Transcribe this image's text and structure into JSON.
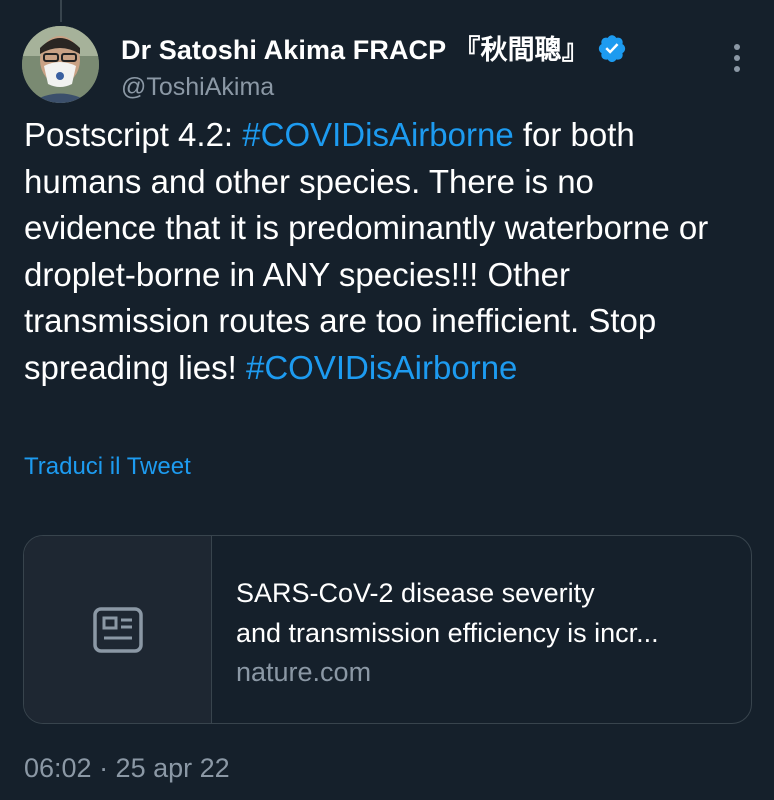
{
  "author": {
    "display_name": "Dr Satoshi Akima FRACP 『秋間聰』",
    "handle": "@ToshiAkima",
    "verified": true
  },
  "tweet": {
    "segments": [
      {
        "text": "Postscript 4.2: ",
        "type": "text"
      },
      {
        "text": "#COVIDisAirborne",
        "type": "hashtag"
      },
      {
        "text": " for both humans and other species. There is no evidence that it is predominantly waterborne or droplet-borne in ANY species!!! Other transmission routes are too inefficient. Stop spreading lies! ",
        "type": "text"
      },
      {
        "text": "#COVIDisAirborne",
        "type": "hashtag"
      }
    ],
    "translate_label": "Traduci il Tweet",
    "timestamp": "06:02 · 25 apr 22"
  },
  "link_card": {
    "icon": "article-icon",
    "title_line1": "SARS-CoV-2 disease severity",
    "title_line2": "and transmission efficiency is incr...",
    "domain": "nature.com"
  },
  "colors": {
    "background": "#15202b",
    "accent": "#1d9bf0",
    "secondary_text": "#8b98a5",
    "border": "#38444d"
  }
}
